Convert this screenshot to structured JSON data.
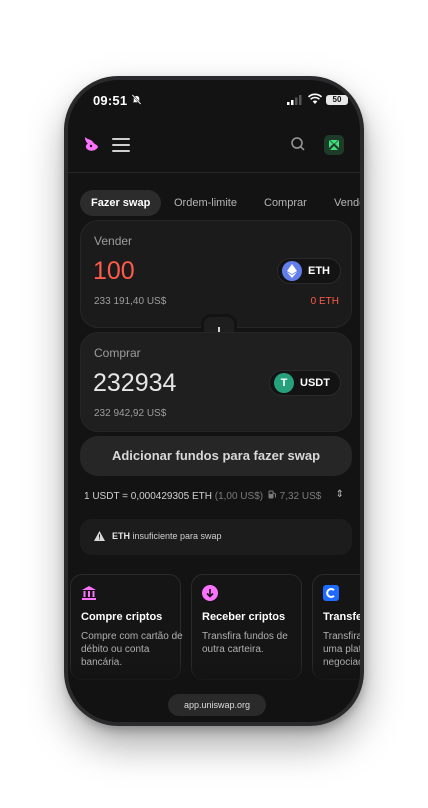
{
  "status": {
    "time": "09:51",
    "battery": "50"
  },
  "tabs": [
    "Fazer swap",
    "Ordem-limite",
    "Comprar",
    "Vender"
  ],
  "sell": {
    "label": "Vender",
    "amount": "100",
    "usd": "233 191,40 US$",
    "token": "ETH",
    "balance": "0 ETH",
    "amount_color": "#ff5a4a"
  },
  "buy": {
    "label": "Comprar",
    "amount": "232934",
    "usd": "232 942,92 US$",
    "token": "USDT"
  },
  "add_funds": "Adicionar fundos para fazer swap",
  "rate": {
    "text": "1 USDT = 0,000429305 ETH",
    "usd": "(1,00 US$)",
    "fee": "7,32 US$"
  },
  "warning": {
    "token": "ETH",
    "text": "insuficiente para swap"
  },
  "features": [
    {
      "title": "Compre criptos",
      "desc": "Compre com cartão de débito ou conta bancária.",
      "icon": "bank-icon",
      "color": "#fc72ff"
    },
    {
      "title": "Receber criptos",
      "desc": "Transfira fundos de outra carteira.",
      "icon": "receive-icon",
      "color": "#fc72ff"
    },
    {
      "title": "Transferir",
      "desc": "Transfira fundos de uma plataforma de negociação.",
      "icon": "coinbase-icon",
      "color": "#1f6bff"
    }
  ],
  "url": "app.uniswap.org",
  "colors": {
    "accent": "#fc72ff",
    "error": "#ff5a4a",
    "eth": "#627eea",
    "usdt": "#26a17b"
  }
}
